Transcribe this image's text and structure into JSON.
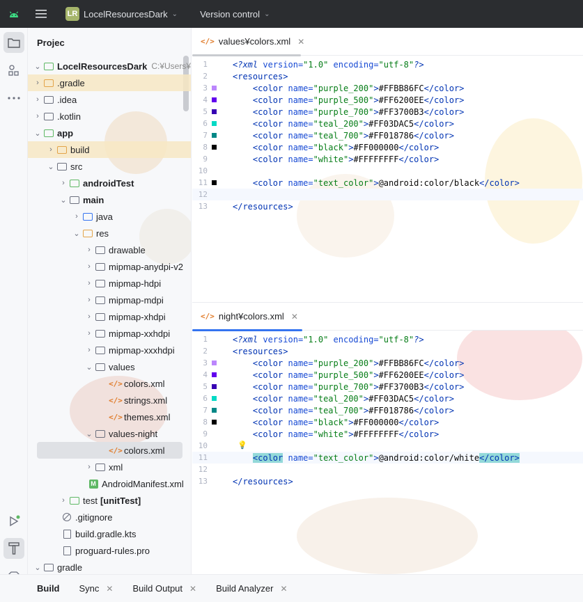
{
  "titlebar": {
    "project_badge": "LR",
    "project_name": "LocelResourcesDark",
    "vcs_label": "Version control"
  },
  "project_panel": {
    "title": "Projec",
    "rows": [
      {
        "label": "LocelResourcesDark",
        "hint": "C:¥Users¥taku"
      },
      {
        "label": ".gradle"
      },
      {
        "label": ".idea"
      },
      {
        "label": ".kotlin"
      },
      {
        "label": "app"
      },
      {
        "label": "build"
      },
      {
        "label": "src"
      },
      {
        "label": "androidTest"
      },
      {
        "label": "main"
      },
      {
        "label": "java"
      },
      {
        "label": "res"
      },
      {
        "label": "drawable"
      },
      {
        "label": "mipmap-anydpi-v2"
      },
      {
        "label": "mipmap-hdpi"
      },
      {
        "label": "mipmap-mdpi"
      },
      {
        "label": "mipmap-xhdpi"
      },
      {
        "label": "mipmap-xxhdpi"
      },
      {
        "label": "mipmap-xxxhdpi"
      },
      {
        "label": "values"
      },
      {
        "label": "colors.xml"
      },
      {
        "label": "strings.xml"
      },
      {
        "label": "themes.xml"
      },
      {
        "label": "values-night"
      },
      {
        "label": "colors.xml"
      },
      {
        "label": "xml"
      },
      {
        "label": "AndroidManifest.xml"
      },
      {
        "label": "test",
        "hint": "[unitTest]"
      },
      {
        "label": ".gitignore"
      },
      {
        "label": "build.gradle.kts"
      },
      {
        "label": "proguard-rules.pro"
      },
      {
        "label": "gradle"
      }
    ]
  },
  "editor_top": {
    "tab_label": "values¥colors.xml",
    "underline_color": "#c9cbd0",
    "line_numbers": [
      "1",
      "2",
      "3",
      "4",
      "5",
      "6",
      "7",
      "8",
      "9",
      "10",
      "11",
      "12",
      "13"
    ]
  },
  "editor_bottom": {
    "tab_label": "night¥colors.xml",
    "underline_color": "#3574f0",
    "line_numbers": [
      "1",
      "2",
      "3",
      "4",
      "5",
      "6",
      "7",
      "8",
      "9",
      "10",
      "11",
      "12",
      "13"
    ]
  },
  "code": {
    "decl_open": "<?",
    "decl_name": "xml",
    "decl_attr1": " version=",
    "decl_val1": "\"1.0\"",
    "decl_attr2": " encoding=",
    "decl_val2": "\"utf-8\"",
    "decl_close": "?>",
    "resources_open": "<resources>",
    "resources_close": "</resources>",
    "color_open": "<color",
    "color_close": "</color>",
    "name_attr": " name=",
    "gt": ">",
    "colors": [
      {
        "name": "\"purple_200\"",
        "value": "#FFBB86FC",
        "swatch": "#BB86FC"
      },
      {
        "name": "\"purple_500\"",
        "value": "#FF6200EE",
        "swatch": "#6200EE"
      },
      {
        "name": "\"purple_700\"",
        "value": "#FF3700B3",
        "swatch": "#3700B3"
      },
      {
        "name": "\"teal_200\"",
        "value": "#FF03DAC5",
        "swatch": "#03DAC5"
      },
      {
        "name": "\"teal_700\"",
        "value": "#FF018786",
        "swatch": "#018786"
      },
      {
        "name": "\"black\"",
        "value": "#FF000000",
        "swatch": "#000000"
      },
      {
        "name": "\"white\"",
        "value": "#FFFFFFFF",
        "swatch": "#FFFFFF"
      }
    ],
    "text_color_name": "\"text_color\"",
    "top_text_color_value": "@android:color/black",
    "bottom_text_color_value": "@android:color/white"
  },
  "bottom_tabs": {
    "build": "Build",
    "sync": "Sync",
    "build_output": "Build Output",
    "build_analyzer": "Build Analyzer"
  },
  "colors": {
    "accent": "#3574f0",
    "highlight_row": "#f7e8c3",
    "bracket_match": "#93d9d9"
  }
}
